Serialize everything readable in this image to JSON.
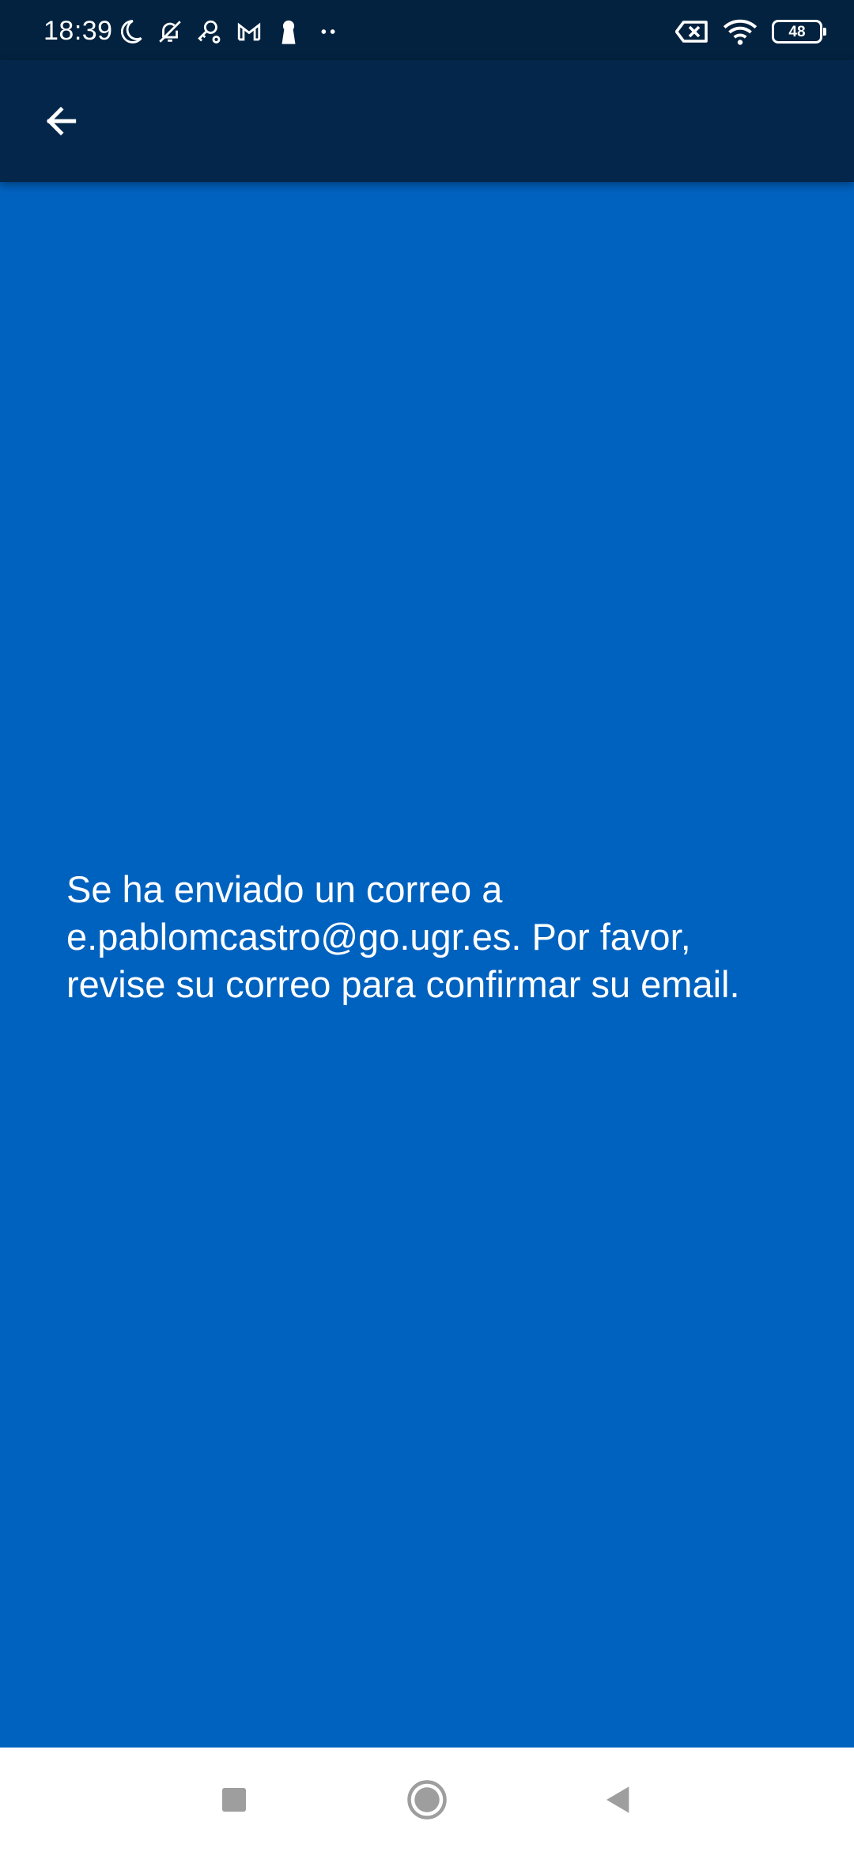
{
  "status_bar": {
    "time": "18:39",
    "battery_level": "48",
    "left_icons": [
      "moon-icon",
      "bell-off-icon",
      "key-icon",
      "gmail-icon",
      "keyhole-icon",
      "more-dots-icon"
    ],
    "right_icons": [
      "data-off-icon",
      "wifi-icon",
      "battery-icon"
    ]
  },
  "app_bar": {
    "back_icon": "arrow-left-icon"
  },
  "message": {
    "text": "Se ha enviado un correo a e.pablomcastro@go.ugr.es. Por favor, revise su correo para confirmar su email."
  },
  "nav_bar": {
    "buttons": [
      "recents",
      "home",
      "back"
    ]
  },
  "colors": {
    "background": "#0062BF",
    "app_bar": "#03264A",
    "status_bar": "#03223F",
    "text": "#FFFFFF",
    "nav_bar": "#FFFFFF",
    "nav_icon": "#9E9E9E"
  }
}
